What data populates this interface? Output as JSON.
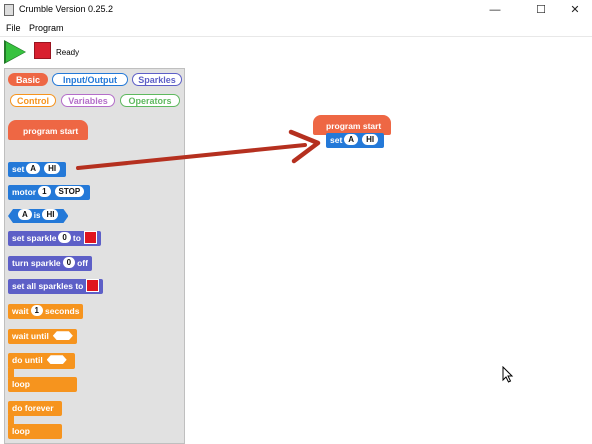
{
  "window": {
    "title": "Crumble Version 0.25.2",
    "minimize": "—",
    "maximize": "☐",
    "close": "✕"
  },
  "menu": {
    "file": "File",
    "program": "Program"
  },
  "toolbar": {
    "status": "Ready"
  },
  "palette": {
    "categories": [
      "Basic",
      "Input/Output",
      "Sparkles",
      "Control",
      "Variables",
      "Operators"
    ],
    "blocks": {
      "program_start": "program start",
      "set": "set",
      "set_a": "A",
      "set_hi": "HI",
      "motor": "motor",
      "motor_num": "1",
      "motor_stop": "STOP",
      "cond_a": "A",
      "cond_is": "is",
      "cond_hi": "HI",
      "set_sparkle": "set sparkle",
      "set_sparkle_num": "0",
      "set_sparkle_to": "to",
      "turn_sparkle": "turn sparkle",
      "turn_sparkle_num": "0",
      "turn_sparkle_off": "off",
      "set_all": "set all sparkles to",
      "wait": "wait",
      "wait_num": "1",
      "wait_unit": "seconds",
      "wait_until": "wait until",
      "do_until": "do until",
      "do_until_loop": "loop",
      "do_forever": "do forever",
      "do_forever_loop": "loop"
    }
  },
  "workspace": {
    "program_start": "program start",
    "set": "set",
    "set_a": "A",
    "set_hi": "HI"
  },
  "colors": {
    "arrow": "#b5301f",
    "basic": "#ee6744",
    "io": "#2479d8",
    "sparkles": "#5d5fc7",
    "control": "#f6941e",
    "variables": "#b46ec9",
    "operators": "#5fb95f"
  }
}
